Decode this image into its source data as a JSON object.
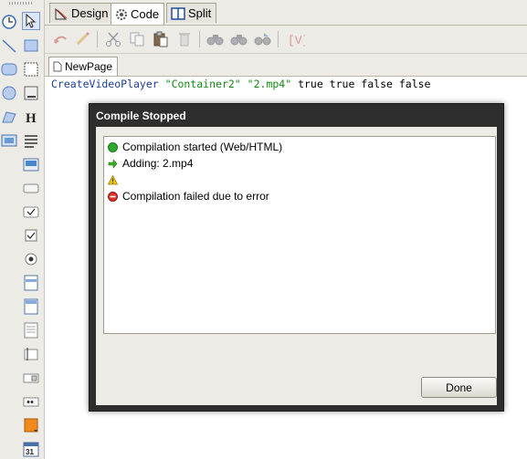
{
  "view_tabs": [
    {
      "label": "Design",
      "icon": "design-icon"
    },
    {
      "label": "Code",
      "icon": "code-icon",
      "active": true
    },
    {
      "label": "Split",
      "icon": "split-icon"
    }
  ],
  "document_tab": {
    "label": "NewPage",
    "icon": "page-icon"
  },
  "code": {
    "function": "CreateVideoPlayer",
    "arg1": "\"Container2\"",
    "arg2": "\"2.mp4\"",
    "rest": "true true false false"
  },
  "dialog": {
    "title": "Compile Stopped",
    "log": [
      {
        "icon": "green-dot-icon",
        "text": "Compilation started (Web/HTML)"
      },
      {
        "icon": "green-arrow-icon",
        "text": "Adding: 2.mp4"
      },
      {
        "icon": "warning-icon",
        "text": ""
      },
      {
        "icon": "error-icon",
        "text": "Compilation failed due to error"
      }
    ],
    "done_label": "Done"
  },
  "colors": {
    "keyword": "#1d3c9b",
    "string": "#138a13",
    "dialog_frame": "#2e2e2e",
    "success": "#2fa82f",
    "error": "#d9342b",
    "warning": "#f2c400"
  }
}
